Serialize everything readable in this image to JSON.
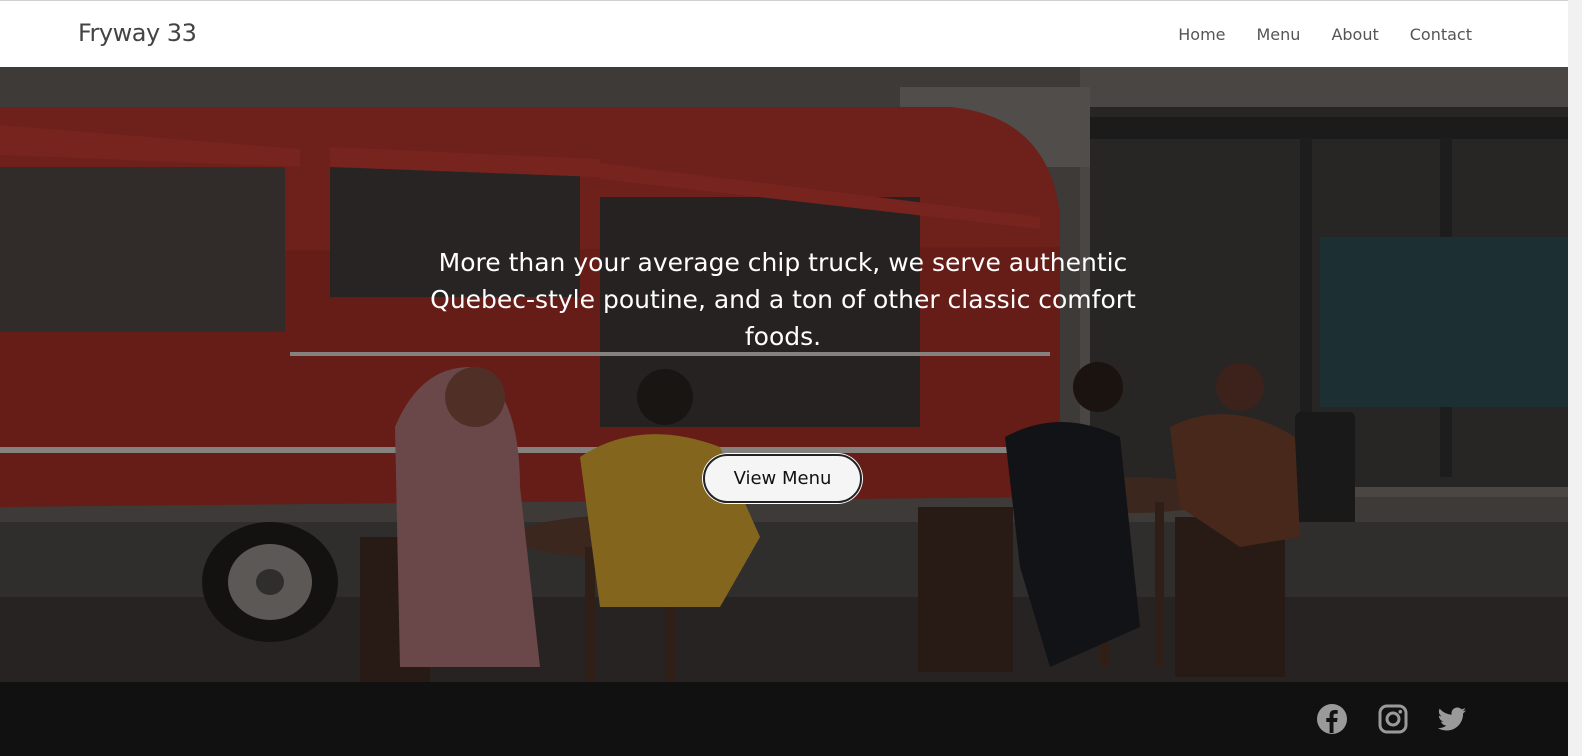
{
  "navbar": {
    "brand": "Fryway 33",
    "links": [
      {
        "label": "Home"
      },
      {
        "label": "Menu"
      },
      {
        "label": "About"
      },
      {
        "label": "Contact"
      }
    ]
  },
  "hero": {
    "tagline": "More than your average chip truck, we serve authentic Quebec-style poutine, and a ton of other classic comfort foods.",
    "cta_label": "View Menu",
    "background_image": "food-truck-photo"
  },
  "footer": {
    "social_icons": [
      "facebook-icon",
      "instagram-icon",
      "twitter-icon"
    ]
  },
  "colors": {
    "navbar_bg": "#ffffff",
    "brand_text": "#444444",
    "nav_text": "#555555",
    "footer_bg": "#111111",
    "icon_color": "#9a9a9a"
  }
}
